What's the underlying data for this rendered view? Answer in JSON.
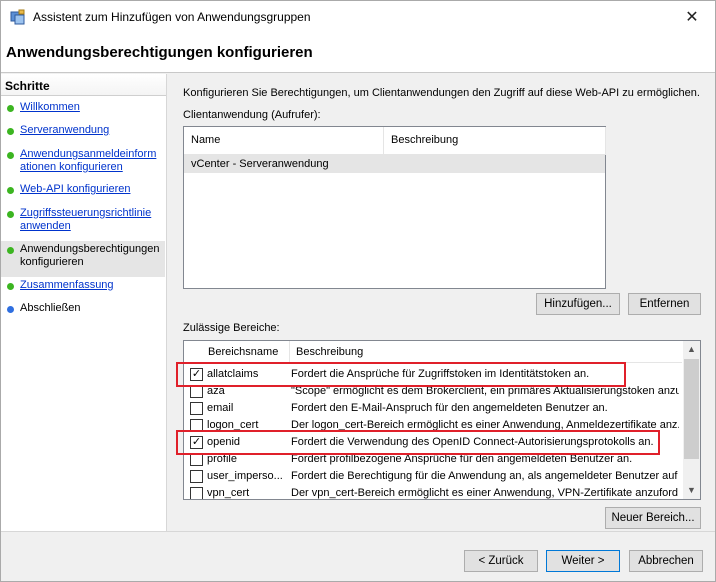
{
  "window": {
    "title": "Assistent zum Hinzufügen von Anwendungsgruppen",
    "close_glyph": "✕"
  },
  "header": {
    "title": "Anwendungsberechtigungen konfigurieren"
  },
  "steps": {
    "heading": "Schritte",
    "items": [
      {
        "label": "Willkommen",
        "state": "done"
      },
      {
        "label": "Serveranwendung",
        "state": "done"
      },
      {
        "label": "Anwendungsanmeldeinformationen konfigurieren",
        "state": "done"
      },
      {
        "label": "Web-API konfigurieren",
        "state": "done"
      },
      {
        "label": "Zugriffssteuerungsrichtlinie anwenden",
        "state": "done"
      },
      {
        "label": "Anwendungsberechtigungen konfigurieren",
        "state": "current"
      },
      {
        "label": "Zusammenfassung",
        "state": "done"
      },
      {
        "label": "Abschließen",
        "state": "pending"
      }
    ]
  },
  "content": {
    "intro": "Konfigurieren Sie Berechtigungen, um Clientanwendungen den Zugriff auf diese Web-API zu ermöglichen.",
    "client_label": "Clientanwendung (Aufrufer):",
    "client_columns": [
      "Name",
      "Beschreibung"
    ],
    "client_rows": [
      {
        "name": "vCenter - Serveranwendung",
        "description": ""
      }
    ],
    "add_button": "Hinzufügen...",
    "remove_button": "Entfernen",
    "scope_label": "Zulässige Bereiche:",
    "scope_columns": [
      "Bereichsname",
      "Beschreibung"
    ],
    "scopes": [
      {
        "name": "allatclaims",
        "description": "Fordert die Ansprüche für Zugriffstoken im Identitätstoken an.",
        "checked": true
      },
      {
        "name": "aza",
        "description": "\"Scope\" ermöglicht es dem Brokerclient, ein primäres Aktualisierungstoken anzu...",
        "checked": false
      },
      {
        "name": "email",
        "description": "Fordert den E-Mail-Anspruch für den angemeldeten Benutzer an.",
        "checked": false
      },
      {
        "name": "logon_cert",
        "description": "Der logon_cert-Bereich ermöglicht es einer Anwendung, Anmeldezertifikate anz...",
        "checked": false
      },
      {
        "name": "openid",
        "description": "Fordert die Verwendung des OpenID Connect-Autorisierungsprotokolls an.",
        "checked": true
      },
      {
        "name": "profile",
        "description": "Fordert profilbezogene Ansprüche für den angemeldeten Benutzer an.",
        "checked": false
      },
      {
        "name": "user_imperso...",
        "description": "Fordert die Berechtigung für die Anwendung an, als angemeldeter Benutzer auf ...",
        "checked": false
      },
      {
        "name": "vpn_cert",
        "description": "Der vpn_cert-Bereich ermöglicht es einer Anwendung, VPN-Zertifikate anzuford...",
        "checked": false
      }
    ],
    "new_scope_button": "Neuer Bereich..."
  },
  "footer": {
    "back_button": "< Zurück",
    "next_button": "Weiter >",
    "cancel_button": "Abbrechen"
  },
  "colors": {
    "done_dot": "#3cb521",
    "pending_dot": "#2f6fe0",
    "highlight": "#e0202a"
  }
}
